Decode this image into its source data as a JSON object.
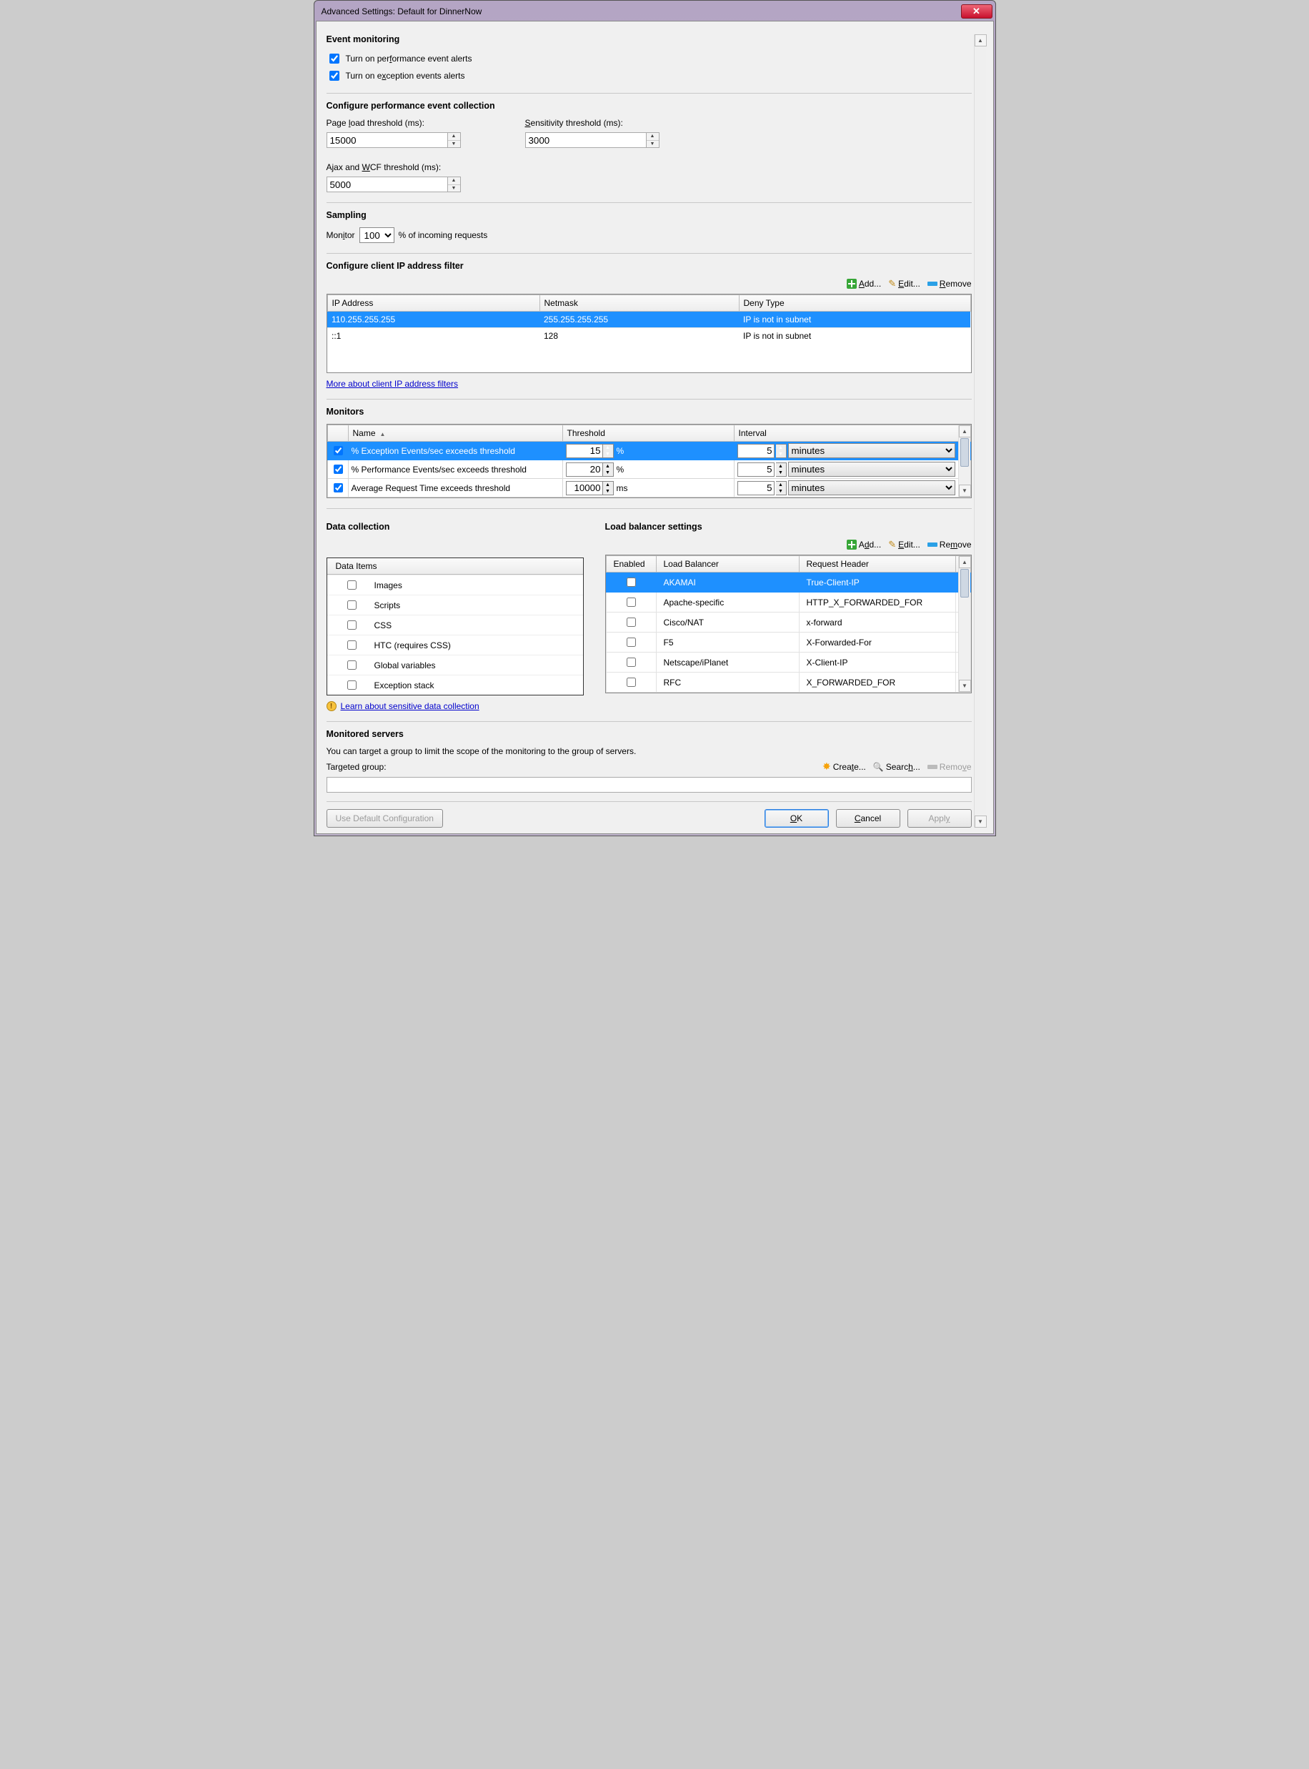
{
  "window": {
    "title": "Advanced Settings: Default for DinnerNow"
  },
  "event_monitoring": {
    "heading": "Event monitoring",
    "perf_alerts_label_pre": "Turn on per",
    "perf_alerts_label_u": "f",
    "perf_alerts_label_post": "ormance event alerts",
    "perf_alerts_checked": true,
    "exc_alerts_label_pre": "Turn on e",
    "exc_alerts_label_u": "x",
    "exc_alerts_label_post": "ception events alerts",
    "exc_alerts_checked": true
  },
  "perf_collection": {
    "heading": "Configure performance event collection",
    "page_load_label_pre": "Page ",
    "page_load_label_u": "l",
    "page_load_label_post": "oad threshold (ms):",
    "page_load_value": "15000",
    "sensitivity_label_u": "S",
    "sensitivity_label_post": "ensitivity threshold (ms):",
    "sensitivity_value": "3000",
    "ajax_label_pre": "Ajax and ",
    "ajax_label_u": "W",
    "ajax_label_post": "CF threshold (ms):",
    "ajax_value": "5000"
  },
  "sampling": {
    "heading": "Sampling",
    "label_pre": "Mon",
    "label_u": "i",
    "label_post": "tor",
    "value": "100",
    "suffix": "% of incoming requests"
  },
  "ip_filter": {
    "heading": "Configure client IP address filter",
    "add_label": "Add...",
    "edit_label": "Edit...",
    "remove_label": "Remove",
    "cols": {
      "ip": "IP Address",
      "mask": "Netmask",
      "deny": "Deny Type"
    },
    "rows": [
      {
        "ip": "110.255.255.255",
        "mask": "255.255.255.255",
        "deny": "IP is not in subnet",
        "selected": true
      },
      {
        "ip": "::1",
        "mask": "128",
        "deny": "IP is not in subnet",
        "selected": false
      }
    ],
    "more_link": "More about client IP address filters"
  },
  "monitors": {
    "heading": "Monitors",
    "cols": {
      "name": "Name",
      "threshold": "Threshold",
      "interval": "Interval"
    },
    "rows": [
      {
        "checked": true,
        "name": "% Exception Events/sec exceeds threshold",
        "threshold": "15",
        "unit": "%",
        "interval": "5",
        "interval_unit": "minutes",
        "selected": true
      },
      {
        "checked": true,
        "name": "% Performance Events/sec exceeds threshold",
        "threshold": "20",
        "unit": "%",
        "interval": "5",
        "interval_unit": "minutes",
        "selected": false
      },
      {
        "checked": true,
        "name": "Average Request Time exceeds threshold",
        "threshold": "10000",
        "unit": "ms",
        "interval": "5",
        "interval_unit": "minutes",
        "selected": false
      }
    ]
  },
  "data_collection": {
    "heading": "Data collection",
    "header": "Data Items",
    "items": [
      {
        "label": "Images",
        "checked": false
      },
      {
        "label": "Scripts",
        "checked": false
      },
      {
        "label": "CSS",
        "checked": false
      },
      {
        "label": "HTC (requires CSS)",
        "checked": false
      },
      {
        "label": "Global variables",
        "checked": false
      },
      {
        "label": "Exception stack",
        "checked": false
      }
    ],
    "learn_link": "Learn about sensitive data collection"
  },
  "load_balancer": {
    "heading": "Load balancer settings",
    "add_label": "Add...",
    "edit_label": "Edit...",
    "remove_label": "Remove",
    "cols": {
      "enabled": "Enabled",
      "name": "Load Balancer",
      "header": "Request Header"
    },
    "rows": [
      {
        "checked": false,
        "name": "AKAMAI",
        "header": "True-Client-IP",
        "selected": true
      },
      {
        "checked": false,
        "name": "Apache-specific",
        "header": "HTTP_X_FORWARDED_FOR",
        "selected": false
      },
      {
        "checked": false,
        "name": "Cisco/NAT",
        "header": "x-forward",
        "selected": false
      },
      {
        "checked": false,
        "name": "F5",
        "header": "X-Forwarded-For",
        "selected": false
      },
      {
        "checked": false,
        "name": "Netscape/iPlanet",
        "header": "X-Client-IP",
        "selected": false
      },
      {
        "checked": false,
        "name": "RFC",
        "header": "X_FORWARDED_FOR",
        "selected": false
      }
    ]
  },
  "monitored_servers": {
    "heading": "Monitored servers",
    "desc": "You can target a group to limit the scope of the monitoring to the group of servers.",
    "label": "Targeted group:",
    "value": "",
    "create_label": "Create...",
    "search_label": "Search...",
    "remove_label": "Remove"
  },
  "footer": {
    "use_default_pre": "Use Default Confi",
    "use_default_u": "g",
    "use_default_post": "uration",
    "ok_u": "O",
    "ok_post": "K",
    "cancel_u": "C",
    "cancel_post": "ancel",
    "apply_pre": "Appl",
    "apply_u": "y"
  }
}
